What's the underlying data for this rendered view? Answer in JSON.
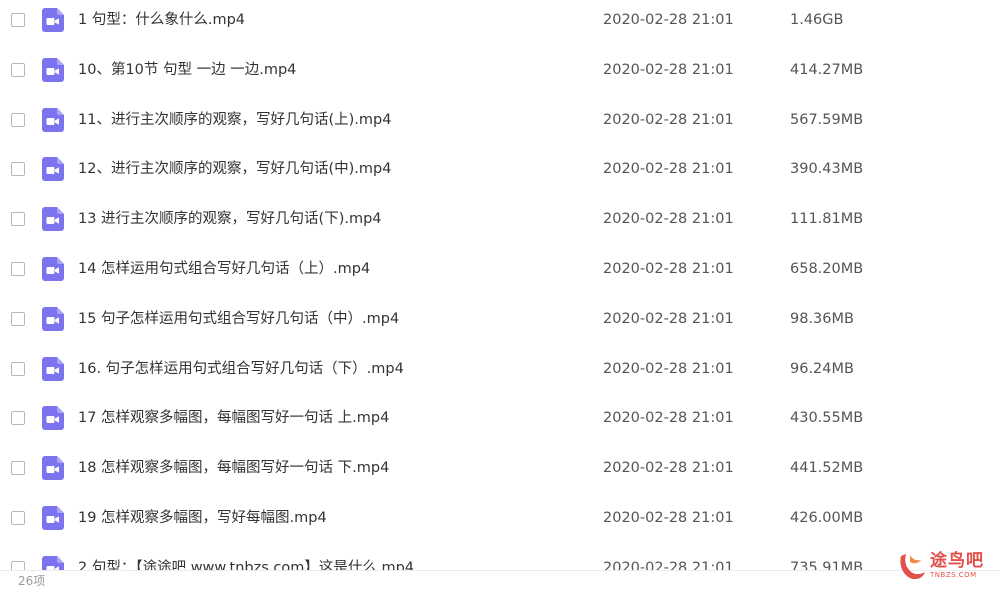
{
  "files": [
    {
      "name": "1 句型：什么象什么.mp4",
      "date": "2020-02-28 21:01",
      "size": "1.46GB"
    },
    {
      "name": "10、第10节 句型 一边  一边.mp4",
      "date": "2020-02-28 21:01",
      "size": "414.27MB"
    },
    {
      "name": "11、进行主次顺序的观察，写好几句话(上).mp4",
      "date": "2020-02-28 21:01",
      "size": "567.59MB"
    },
    {
      "name": "12、进行主次顺序的观察，写好几句话(中).mp4",
      "date": "2020-02-28 21:01",
      "size": "390.43MB"
    },
    {
      "name": "13  进行主次顺序的观察，写好几句话(下).mp4",
      "date": "2020-02-28 21:01",
      "size": "111.81MB"
    },
    {
      "name": "14 怎样运用句式组合写好几句话（上）.mp4",
      "date": "2020-02-28 21:01",
      "size": "658.20MB"
    },
    {
      "name": "15 句子怎样运用句式组合写好几句话（中）.mp4",
      "date": "2020-02-28 21:01",
      "size": "98.36MB"
    },
    {
      "name": "16. 句子怎样运用句式组合写好几句话（下）.mp4",
      "date": "2020-02-28 21:01",
      "size": "96.24MB"
    },
    {
      "name": "17 怎样观察多幅图，每幅图写好一句话  上.mp4",
      "date": "2020-02-28 21:01",
      "size": "430.55MB"
    },
    {
      "name": "18 怎样观察多幅图，每幅图写好一句话  下.mp4",
      "date": "2020-02-28 21:01",
      "size": "441.52MB"
    },
    {
      "name": "19 怎样观察多幅图，写好每幅图.mp4",
      "date": "2020-02-28 21:01",
      "size": "426.00MB"
    },
    {
      "name": "2 句型：【途途吧 www.tnbzs.com】这是什么.mp4",
      "date": "2020-02-28 21:01",
      "size": "735.91MB"
    }
  ],
  "status": {
    "item_count": "26项"
  },
  "watermark": {
    "brand": "途鸟吧",
    "domain": "TNBZS.COM"
  },
  "colors": {
    "video_icon": "#7b74ee",
    "watermark": "#e1504a",
    "text": "#333333",
    "meta_text": "#555555"
  },
  "icons": {
    "file": "video-file-icon",
    "watermark": "bird-logo-icon"
  }
}
